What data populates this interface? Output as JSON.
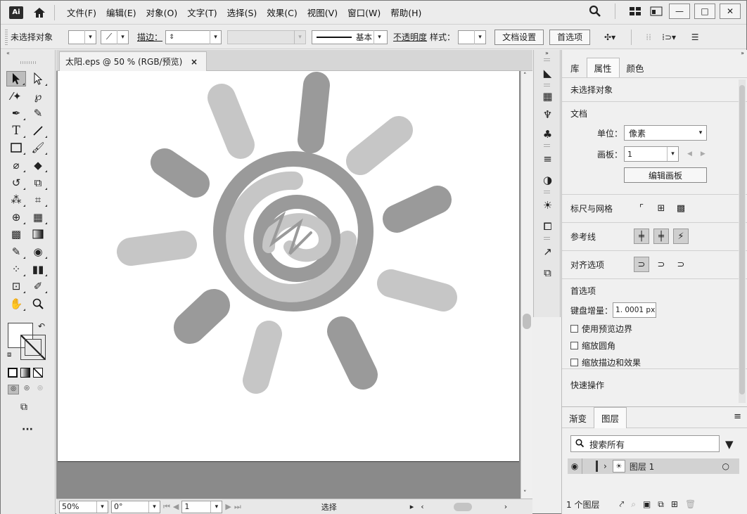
{
  "app": {
    "logo_text": "Ai"
  },
  "menu": [
    "文件(F)",
    "编辑(E)",
    "对象(O)",
    "文字(T)",
    "选择(S)",
    "效果(C)",
    "视图(V)",
    "窗口(W)",
    "帮助(H)"
  ],
  "control_bar": {
    "selection_status": "未选择对象",
    "stroke_label": "描边：",
    "stroke_style": "基本",
    "opacity_label": "不透明度",
    "style_label": "样式：",
    "doc_setup": "文档设置",
    "preferences": "首选项"
  },
  "document": {
    "tab_title": "太阳.eps @ 50 % (RGB/预览)",
    "close_glyph": "×"
  },
  "statusbar": {
    "zoom": "50%",
    "rotation": "0°",
    "artboard_num": "1",
    "tool": "选择"
  },
  "properties": {
    "tabs": [
      "库",
      "属性",
      "颜色"
    ],
    "active_tab": "属性",
    "selection": "未选择对象",
    "doc_section": "文档",
    "unit_label": "单位：",
    "unit_value": "像素",
    "artboard_label": "画板：",
    "artboard_value": "1",
    "edit_artboards": "编辑画板",
    "rulers_grid": "标尺与网格",
    "guides": "参考线",
    "snap": "对齐选项",
    "prefs_section": "首选项",
    "keyboard_inc_label": "键盘增量：",
    "keyboard_inc_value": "1. 0001 px",
    "checkboxes": [
      "使用预览边界",
      "缩放圆角",
      "缩放描边和效果"
    ],
    "quick_actions": "快速操作"
  },
  "layers": {
    "tabs": [
      "渐变",
      "图层"
    ],
    "active_tab": "图层",
    "search_placeholder": "搜索所有",
    "layer_name": "图层 1",
    "count": "1 个图层"
  },
  "colors": {
    "sun_dark": "#9a9a9a",
    "sun_light": "#c6c6c6"
  }
}
